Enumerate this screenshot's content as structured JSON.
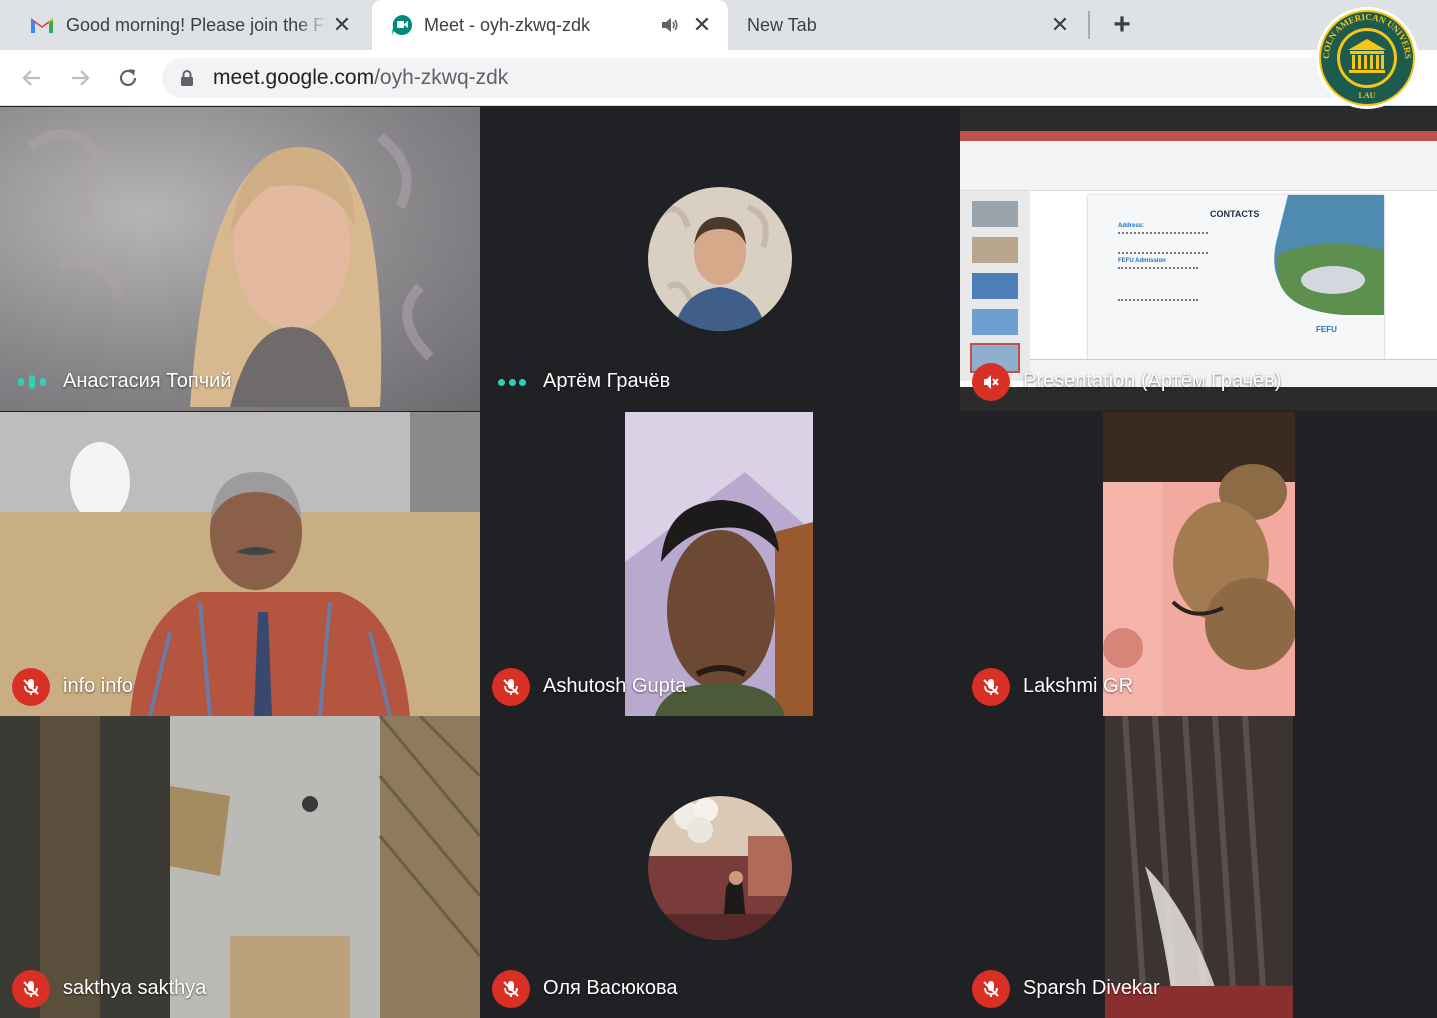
{
  "browser": {
    "tabs": [
      {
        "title": "Good morning! Please join the FEFU",
        "icon": "gmail-icon",
        "active": false
      },
      {
        "title": "Meet - oyh-zkwq-zdk",
        "icon": "meet-icon",
        "active": true,
        "audio": true
      },
      {
        "title": "New Tab",
        "icon": null,
        "active": false
      }
    ],
    "new_tab_label": "+",
    "close_glyph": "✕",
    "url": {
      "host": "meet.google.com",
      "path": "/oyh-zkwq-zdk"
    }
  },
  "logo": {
    "text": "LINCOLN AMERICAN UNIVERSITY",
    "initials": "LAU"
  },
  "meet": {
    "participants": [
      {
        "name": "Анастасия Топчий",
        "status": "speaking"
      },
      {
        "name": "Артём Грачёв",
        "status": "active"
      },
      {
        "name": "Presentation (Артём Грачёв)",
        "status": "muted"
      },
      {
        "name": "info info",
        "status": "muted"
      },
      {
        "name": "Ashutosh Gupta",
        "status": "muted"
      },
      {
        "name": "Lakshmi GR",
        "status": "muted"
      },
      {
        "name": "sakthya sakthya",
        "status": "muted"
      },
      {
        "name": "Оля Васюкова",
        "status": "muted"
      },
      {
        "name": "Sparsh Divekar",
        "status": "muted"
      }
    ],
    "slide": {
      "heading": "CONTACTS",
      "address_label": "Address:",
      "admission_label": "FEFU Admission"
    }
  },
  "colors": {
    "mute": "#d93025",
    "speaking": "#2dd1b8",
    "tile_bg": "#3c4043",
    "page_bg": "#202124"
  }
}
